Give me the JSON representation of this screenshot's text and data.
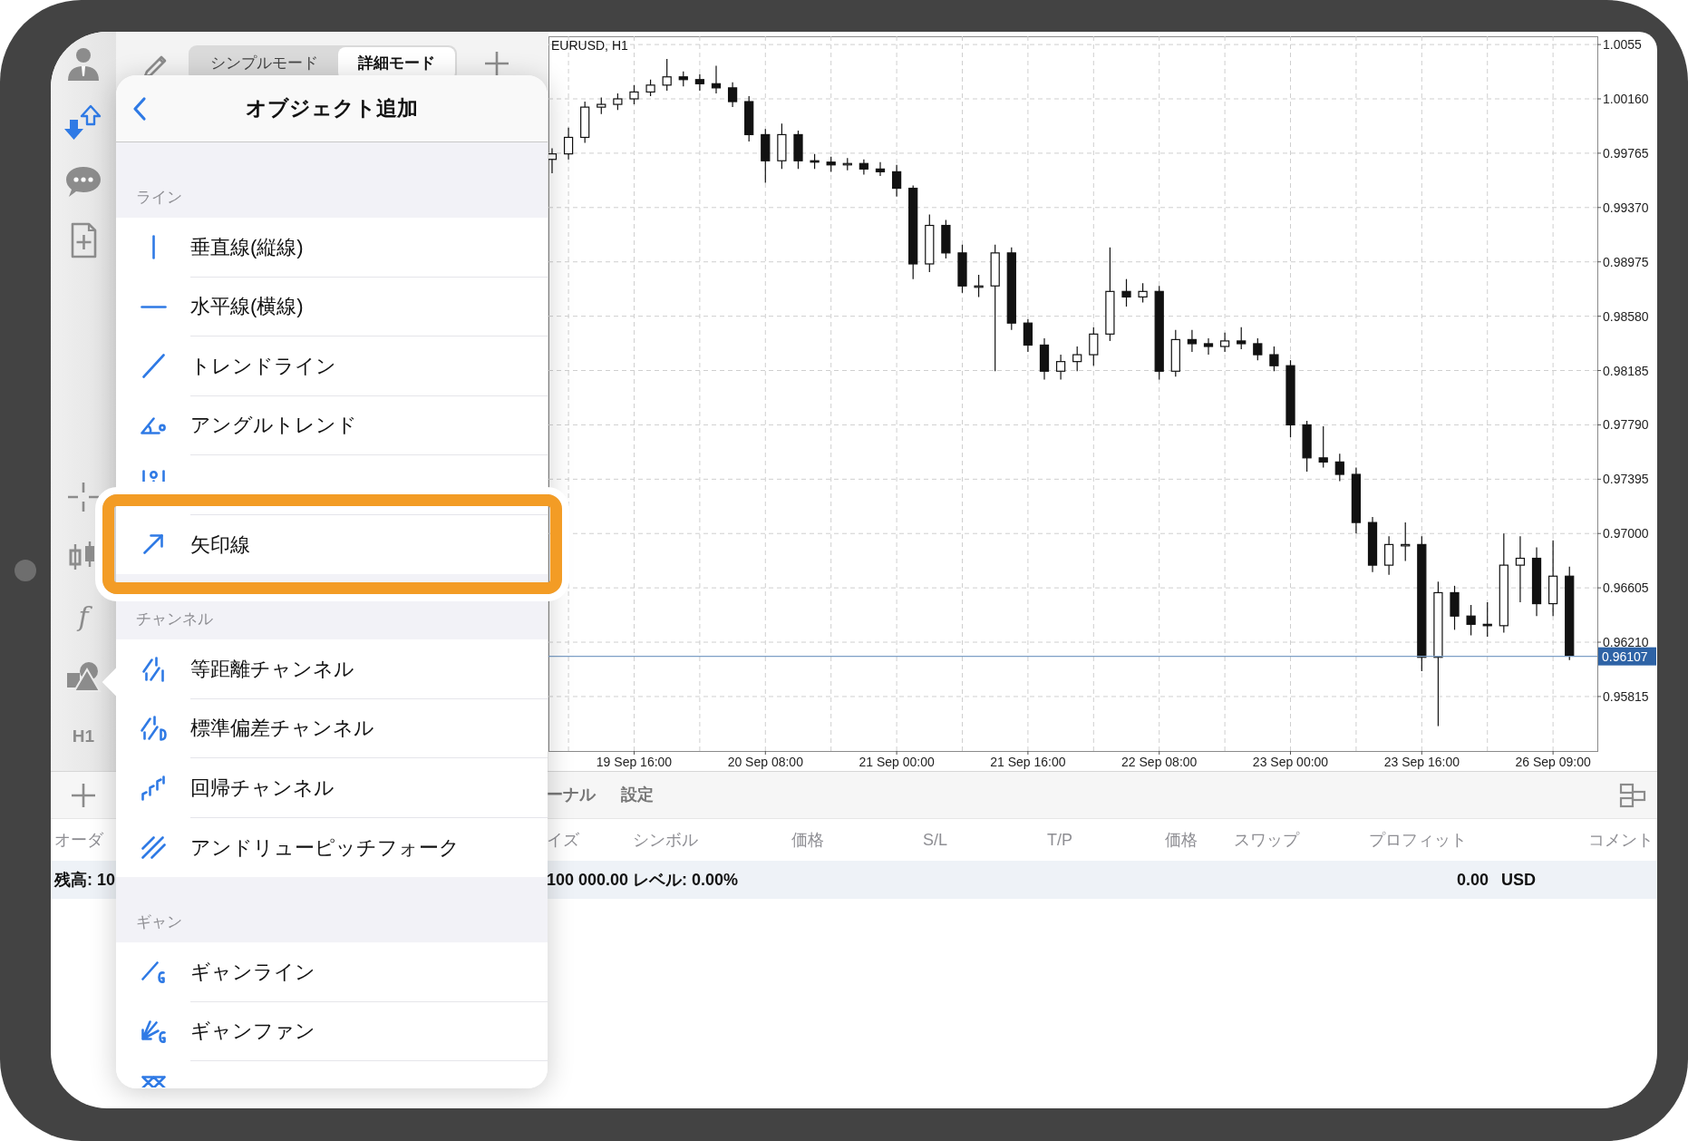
{
  "toolbar": {
    "mode_tabs": [
      {
        "label": "シンプルモード",
        "selected": false
      },
      {
        "label": "詳細モード",
        "selected": true
      }
    ]
  },
  "rail": {
    "function_label": "f",
    "timeframe": "H1"
  },
  "object_menu": {
    "title": "オブジェクト追加",
    "sections": [
      {
        "label": "ライン",
        "items": [
          {
            "label": "垂直線(縦線)",
            "highlighted": false
          },
          {
            "label": "水平線(横線)",
            "highlighted": false
          },
          {
            "label": "トレンドライン",
            "highlighted": false
          },
          {
            "label": "アングルトレンド",
            "highlighted": false
          },
          {
            "highlighted": false
          },
          {
            "label": "矢印線",
            "highlighted": true
          }
        ]
      },
      {
        "label": "チャンネル",
        "items": [
          {
            "label": "等距離チャンネル",
            "highlighted": false
          },
          {
            "label": "標準偏差チャンネル",
            "highlighted": false
          },
          {
            "label": "回帰チャンネル",
            "highlighted": false
          },
          {
            "label": "アンドリューピッチフォーク",
            "highlighted": false
          }
        ]
      },
      {
        "label": "ギャン",
        "items": [
          {
            "label": "ギャンライン",
            "highlighted": false
          },
          {
            "label": "ギャンファン",
            "highlighted": false
          },
          {
            "highlighted": false
          }
        ]
      }
    ]
  },
  "chart": {
    "chart_data": {
      "type": "candlestick",
      "title": "EURUSD, H1",
      "categories": [
        null,
        null,
        null,
        null,
        null,
        "19 Sep 16:00",
        null,
        null,
        null,
        null,
        null,
        null,
        null,
        "20 Sep 08:00",
        null,
        null,
        null,
        null,
        null,
        null,
        null,
        "21 Sep 00:00",
        null,
        null,
        null,
        null,
        null,
        null,
        null,
        "21 Sep 16:00",
        null,
        null,
        null,
        null,
        null,
        null,
        null,
        "22 Sep 08:00",
        null,
        null,
        null,
        null,
        null,
        null,
        null,
        "23 Sep 00:00",
        null,
        null,
        null,
        null,
        null,
        null,
        null,
        "23 Sep 16:00",
        null,
        null,
        null,
        null,
        null,
        null,
        null,
        "26 Sep 09:00",
        null
      ],
      "series": [
        {
          "ohlc": [
            [
              0.9972,
              0.998,
              0.9962,
              0.9976
            ],
            [
              0.9976,
              0.9995,
              0.9972,
              0.9988
            ],
            [
              0.9988,
              1.0014,
              0.9984,
              1.001
            ],
            [
              1.001,
              1.0017,
              1.0005,
              1.0012
            ],
            [
              1.0012,
              1.002,
              1.0008,
              1.0016
            ],
            [
              1.0016,
              1.0026,
              1.0012,
              1.0021
            ],
            [
              1.0021,
              1.003,
              1.0018,
              1.0026
            ],
            [
              1.0026,
              1.0045,
              1.0022,
              1.0032
            ],
            [
              1.0032,
              1.0036,
              1.0025,
              1.003
            ],
            [
              1.003,
              1.0034,
              1.0022,
              1.0027
            ],
            [
              1.0027,
              1.004,
              1.002,
              1.0024
            ],
            [
              1.0024,
              1.0028,
              1.001,
              1.0014
            ],
            [
              1.0014,
              1.0018,
              0.9985,
              0.999
            ],
            [
              0.999,
              0.9994,
              0.9955,
              0.9971
            ],
            [
              0.9971,
              0.9998,
              0.9965,
              0.999
            ],
            [
              0.999,
              0.9993,
              0.9965,
              0.9971
            ],
            [
              0.9971,
              0.9976,
              0.9965,
              0.997
            ],
            [
              0.997,
              0.9974,
              0.9963,
              0.9968
            ],
            [
              0.9968,
              0.9973,
              0.9964,
              0.9969
            ],
            [
              0.9969,
              0.9972,
              0.9961,
              0.9965
            ],
            [
              0.9965,
              0.997,
              0.996,
              0.9963
            ],
            [
              0.9963,
              0.9968,
              0.9945,
              0.9951
            ],
            [
              0.9951,
              0.9953,
              0.9885,
              0.9896
            ],
            [
              0.9896,
              0.9932,
              0.989,
              0.9924
            ],
            [
              0.9924,
              0.9928,
              0.99,
              0.9904
            ],
            [
              0.9904,
              0.991,
              0.9875,
              0.988
            ],
            [
              0.988,
              0.9888,
              0.9872,
              0.988
            ],
            [
              0.988,
              0.991,
              0.9818,
              0.9904
            ],
            [
              0.9904,
              0.9908,
              0.9848,
              0.9853
            ],
            [
              0.9853,
              0.9856,
              0.9832,
              0.9837
            ],
            [
              0.9837,
              0.9842,
              0.9812,
              0.9818
            ],
            [
              0.9818,
              0.983,
              0.9812,
              0.9825
            ],
            [
              0.9825,
              0.9836,
              0.9818,
              0.983
            ],
            [
              0.983,
              0.985,
              0.9822,
              0.9845
            ],
            [
              0.9845,
              0.9908,
              0.984,
              0.9876
            ],
            [
              0.9876,
              0.9885,
              0.9865,
              0.9872
            ],
            [
              0.9872,
              0.9882,
              0.9868,
              0.9876
            ],
            [
              0.9876,
              0.988,
              0.9812,
              0.9818
            ],
            [
              0.9818,
              0.9848,
              0.9814,
              0.9841
            ],
            [
              0.9841,
              0.9848,
              0.9832,
              0.9838
            ],
            [
              0.9838,
              0.9842,
              0.983,
              0.9836
            ],
            [
              0.9836,
              0.9846,
              0.9832,
              0.984
            ],
            [
              0.984,
              0.985,
              0.9834,
              0.9838
            ],
            [
              0.9838,
              0.9842,
              0.9826,
              0.983
            ],
            [
              0.983,
              0.9836,
              0.9818,
              0.9822
            ],
            [
              0.9822,
              0.9826,
              0.977,
              0.9779
            ],
            [
              0.9779,
              0.9782,
              0.9745,
              0.9755
            ],
            [
              0.9755,
              0.9778,
              0.9748,
              0.9752
            ],
            [
              0.9752,
              0.9758,
              0.9738,
              0.9743
            ],
            [
              0.9743,
              0.9748,
              0.97,
              0.9708
            ],
            [
              0.9708,
              0.9712,
              0.9672,
              0.9677
            ],
            [
              0.9677,
              0.9698,
              0.967,
              0.9692
            ],
            [
              0.9692,
              0.9708,
              0.968,
              0.9692
            ],
            [
              0.9692,
              0.9698,
              0.96,
              0.961
            ],
            [
              0.961,
              0.9665,
              0.956,
              0.9657
            ],
            [
              0.9657,
              0.9662,
              0.963,
              0.964
            ],
            [
              0.964,
              0.9648,
              0.9626,
              0.9634
            ],
            [
              0.9634,
              0.965,
              0.9625,
              0.9633
            ],
            [
              0.9633,
              0.97,
              0.9628,
              0.9677
            ],
            [
              0.9677,
              0.9698,
              0.965,
              0.9682
            ],
            [
              0.9682,
              0.969,
              0.964,
              0.9649
            ],
            [
              0.9649,
              0.9695,
              0.964,
              0.9669
            ],
            [
              0.9669,
              0.9676,
              0.9608,
              0.9611
            ]
          ]
        }
      ],
      "ylim": [
        0.95419,
        1.00615
      ],
      "yticks": [
        {
          "value": 1.00555,
          "label": "1.0055"
        },
        {
          "value": 1.0016,
          "label": "1.00160"
        },
        {
          "value": 0.99765,
          "label": "0.99765"
        },
        {
          "value": 0.9937,
          "label": "0.99370"
        },
        {
          "value": 0.98975,
          "label": "0.98975"
        },
        {
          "value": 0.9858,
          "label": "0.98580"
        },
        {
          "value": 0.98185,
          "label": "0.98185"
        },
        {
          "value": 0.9779,
          "label": "0.97790"
        },
        {
          "value": 0.97395,
          "label": "0.97395"
        },
        {
          "value": 0.97,
          "label": "0.97000"
        },
        {
          "value": 0.96605,
          "label": "0.96605"
        },
        {
          "value": 0.9621,
          "label": "0.96210"
        },
        {
          "value": 0.95815,
          "label": "0.95815"
        }
      ],
      "grid": true,
      "ref_lines": [
        {
          "axis": "y",
          "value": 0.96107,
          "label": "0.96107"
        }
      ]
    }
  },
  "terminal": {
    "tabs": [
      "ーナル",
      "設定"
    ],
    "columns": [
      "オーダ",
      "イズ",
      "シンボル",
      "価格",
      "S/L",
      "T/P",
      "価格",
      "スワップ",
      "プロフィット",
      "コメント"
    ],
    "balance": {
      "label": "残高: 10",
      "summary": "100 000.00 レベル: 0.00%",
      "profit": "0.00",
      "currency": "USD"
    }
  }
}
